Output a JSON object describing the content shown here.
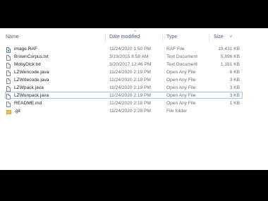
{
  "header": {
    "name": "Name",
    "date_modified": "Date modified",
    "type": "Type",
    "size": "Size"
  },
  "files": [
    {
      "name": "image.RAF",
      "date": "11/24/2020 1:50 PM",
      "type": "RAF File",
      "size": "19,431 KB",
      "icon": "raf-file-icon"
    },
    {
      "name": "BrownCorpus.txt",
      "date": "3/19/2015 8:59 AM",
      "type": "Text Document",
      "size": "5,896 KB",
      "icon": "text-file-icon"
    },
    {
      "name": "MobyDick.txt",
      "date": "3/20/2017 12:46 PM",
      "type": "Text Document",
      "size": "1,181 KB",
      "icon": "text-file-icon"
    },
    {
      "name": "LZWencode.java",
      "date": "11/24/2020 2:19 PM",
      "type": "Open Any File",
      "size": "6 KB",
      "icon": "java-file-icon"
    },
    {
      "name": "LZWdecode.java",
      "date": "11/24/2020 2:18 PM",
      "type": "Open Any File",
      "size": "3 KB",
      "icon": "java-file-icon"
    },
    {
      "name": "LZWpack.java",
      "date": "11/24/2020 2:19 PM",
      "type": "Open Any File",
      "size": "3 KB",
      "icon": "java-file-icon"
    },
    {
      "name": "LZWunpack.java",
      "date": "11/24/2020 2:19 PM",
      "type": "Open Any File",
      "size": "3 KB",
      "icon": "java-file-icon"
    },
    {
      "name": "README.md",
      "date": "11/24/2020 2:18 PM",
      "type": "Open Any File",
      "size": "1 KB",
      "icon": "md-file-icon"
    },
    {
      "name": ".git",
      "date": "11/24/2020 2:28 PM",
      "type": "File folder",
      "size": "",
      "icon": "folder-icon"
    }
  ]
}
